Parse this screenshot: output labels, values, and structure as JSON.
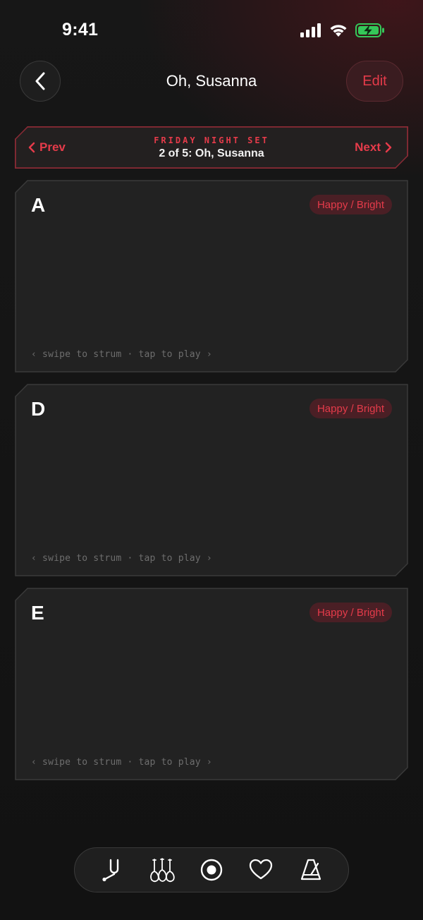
{
  "status_bar": {
    "time": "9:41"
  },
  "header": {
    "title": "Oh, Susanna",
    "edit_label": "Edit"
  },
  "set_nav": {
    "prev_label": "Prev",
    "next_label": "Next",
    "set_name": "FRIDAY NIGHT SET",
    "position": "2 of 5: Oh, Susanna"
  },
  "chords": [
    {
      "name": "A",
      "mood": "Happy / Bright",
      "hint": "‹ swipe to strum · tap to play ›"
    },
    {
      "name": "D",
      "mood": "Happy / Bright",
      "hint": "‹ swipe to strum · tap to play ›"
    },
    {
      "name": "E",
      "mood": "Happy / Bright",
      "hint": "‹ swipe to strum · tap to play ›"
    }
  ],
  "tabs": [
    {
      "icon": "tuning-fork-icon"
    },
    {
      "icon": "instruments-icon"
    },
    {
      "icon": "record-icon"
    },
    {
      "icon": "heart-icon"
    },
    {
      "icon": "metronome-icon"
    }
  ],
  "colors": {
    "accent": "#e53b4a",
    "background": "#141414",
    "card": "#222222",
    "battery": "#35c759"
  }
}
